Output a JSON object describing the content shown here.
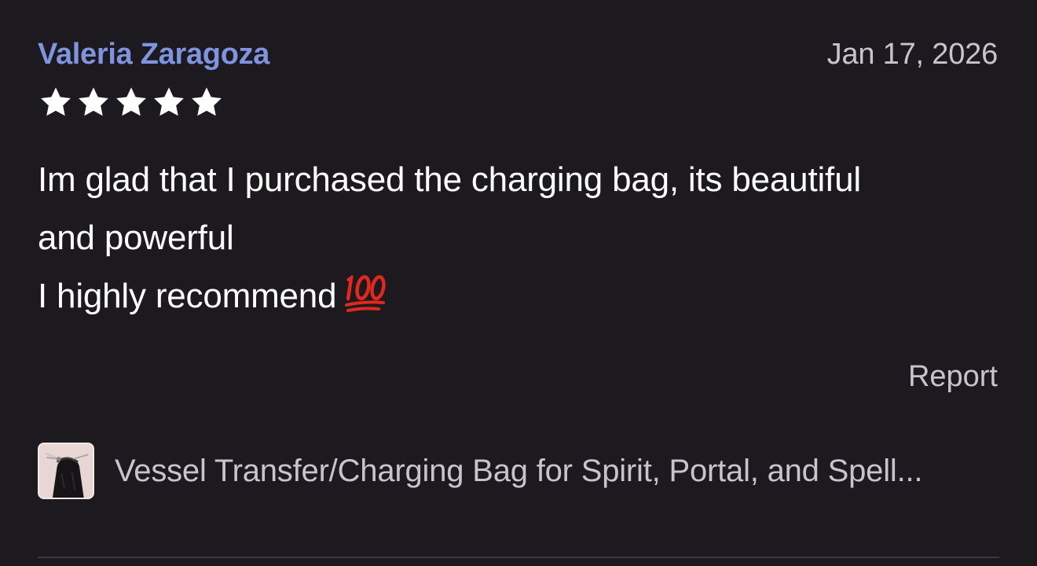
{
  "review": {
    "reviewer_name": "Valeria Zaragoza",
    "date": "Jan 17, 2026",
    "rating": 5,
    "rating_max": 5,
    "body_lines": [
      "Im glad that I purchased the charging bag, its beautiful",
      "and powerful",
      "I highly recommend"
    ],
    "emoji": "hundred-points-icon",
    "report_label": "Report",
    "product_title": "Vessel Transfer/Charging Bag for Spirit, Portal, and Spell..."
  },
  "colors": {
    "background": "#1c1a1f",
    "reviewer_name": "#7f93df",
    "muted_text": "#c9c4cc",
    "body_text": "#ffffff",
    "star": "#ffffff",
    "emoji_red": "#e0281f"
  },
  "icons": {
    "star": "star-icon",
    "product_thumbnail": "product-thumbnail"
  }
}
